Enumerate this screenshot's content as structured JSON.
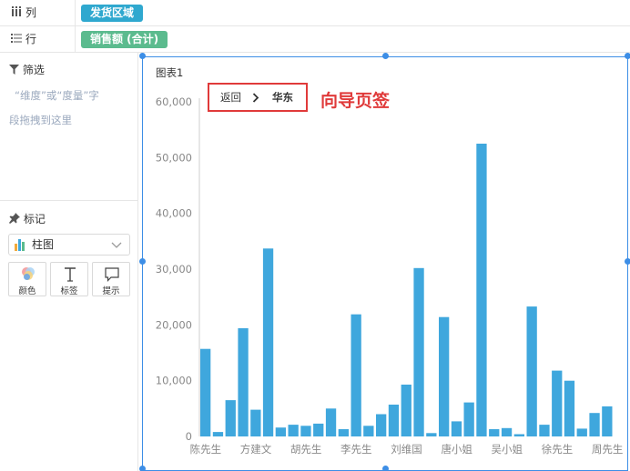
{
  "shelves": {
    "columns": {
      "label": "列",
      "field": "发货区域",
      "icon": "column-bars-icon"
    },
    "rows": {
      "label": "行",
      "field": "销售额 (合计)",
      "icon": "list-icon"
    }
  },
  "filter": {
    "title": "筛选",
    "hint_line1": "“维度”或“度量”字",
    "hint_line2": "段拖拽到这里"
  },
  "marks": {
    "title": "标记",
    "chart_type": "柱图",
    "buttons": [
      {
        "label": "颜色",
        "icon": "color-palette-icon"
      },
      {
        "label": "标签",
        "icon": "text-label-icon"
      },
      {
        "label": "提示",
        "icon": "tooltip-icon"
      }
    ]
  },
  "chart_title": "图表1",
  "navigator": {
    "back_label": "返回",
    "current": "华东"
  },
  "annotation": "向导页签",
  "colors": {
    "bar": "#3fa7dd",
    "canvas_border": "#3d8ee6",
    "annotation": "#e03a3a",
    "pill_blue": "#2fa8cf",
    "pill_green": "#5bbb8e"
  },
  "chart_data": {
    "type": "bar",
    "ylim": [
      0,
      60000
    ],
    "yticks": [
      "0",
      "10,000",
      "20,000",
      "30,000",
      "40,000",
      "50,000",
      "60,000"
    ],
    "xtick_labels": [
      "陈先生",
      "方建文",
      "胡先生",
      "李先生",
      "刘维国",
      "唐小姐",
      "吴小姐",
      "徐先生",
      "周先生"
    ],
    "values": [
      15700,
      800,
      6500,
      19400,
      4800,
      33700,
      1600,
      2100,
      1900,
      2300,
      5000,
      1300,
      21900,
      1900,
      4000,
      5700,
      9300,
      30200,
      600,
      21400,
      2700,
      6100,
      52500,
      1300,
      1500,
      400,
      23300,
      2100,
      11800,
      10000,
      1400,
      4200,
      5400
    ]
  }
}
